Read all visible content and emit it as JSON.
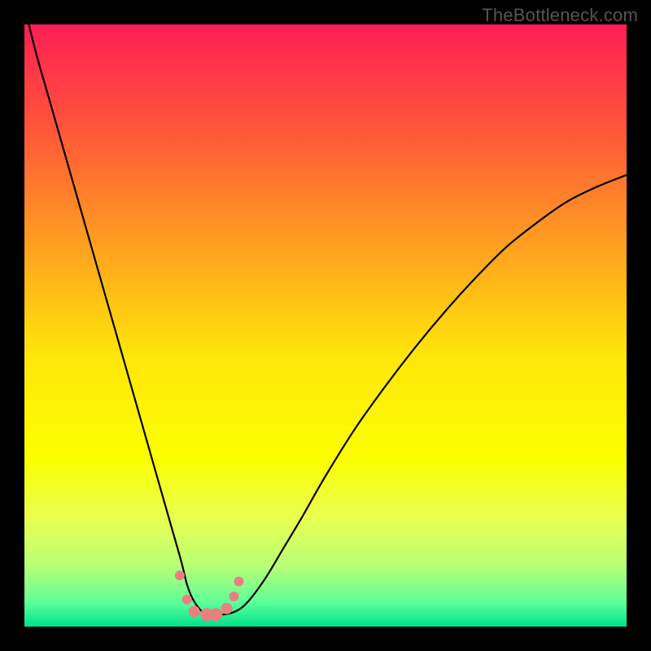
{
  "watermark": "TheBottleneck.com",
  "chart_data": {
    "type": "line",
    "title": "",
    "xlabel": "",
    "ylabel": "",
    "xlim": [
      0,
      100
    ],
    "ylim": [
      0,
      100
    ],
    "grid": false,
    "legend": false,
    "background_gradient": {
      "stops": [
        {
          "offset": 0.0,
          "color": "#ff1e55"
        },
        {
          "offset": 0.18,
          "color": "#ff5838"
        },
        {
          "offset": 0.38,
          "color": "#ffa51e"
        },
        {
          "offset": 0.55,
          "color": "#ffe60a"
        },
        {
          "offset": 0.72,
          "color": "#fcff00"
        },
        {
          "offset": 0.82,
          "color": "#e9ff50"
        },
        {
          "offset": 0.9,
          "color": "#b8ff76"
        },
        {
          "offset": 0.96,
          "color": "#5dff9a"
        },
        {
          "offset": 1.0,
          "color": "#00e28a"
        }
      ]
    },
    "series": [
      {
        "name": "curve",
        "color": "#000000",
        "x": [
          0,
          2,
          4,
          6,
          8,
          10,
          12,
          14,
          16,
          18,
          20,
          22,
          24,
          26,
          27,
          28,
          29.5,
          31,
          33,
          35,
          37,
          40,
          43,
          46,
          50,
          55,
          60,
          65,
          70,
          75,
          80,
          85,
          90,
          95,
          100
        ],
        "y": [
          103,
          95,
          88,
          81,
          74,
          67,
          60,
          53,
          46,
          39,
          32,
          25,
          18,
          11,
          7,
          4.5,
          2.5,
          2,
          2,
          2.5,
          4,
          8,
          13,
          18,
          25,
          33,
          40,
          46.5,
          52.5,
          58,
          63,
          67,
          70.5,
          73,
          75
        ]
      }
    ],
    "markers": {
      "name": "highlight-points",
      "shape": "circle",
      "color": "#e98080",
      "x": [
        25.8,
        27.0,
        28.2,
        30.3,
        31.8,
        33.6,
        34.8,
        35.6
      ],
      "y": [
        8.5,
        4.5,
        2.5,
        2.0,
        2.0,
        3.0,
        5.0,
        7.5
      ],
      "r": [
        6,
        6,
        7,
        8,
        8,
        7,
        6,
        6
      ]
    }
  }
}
